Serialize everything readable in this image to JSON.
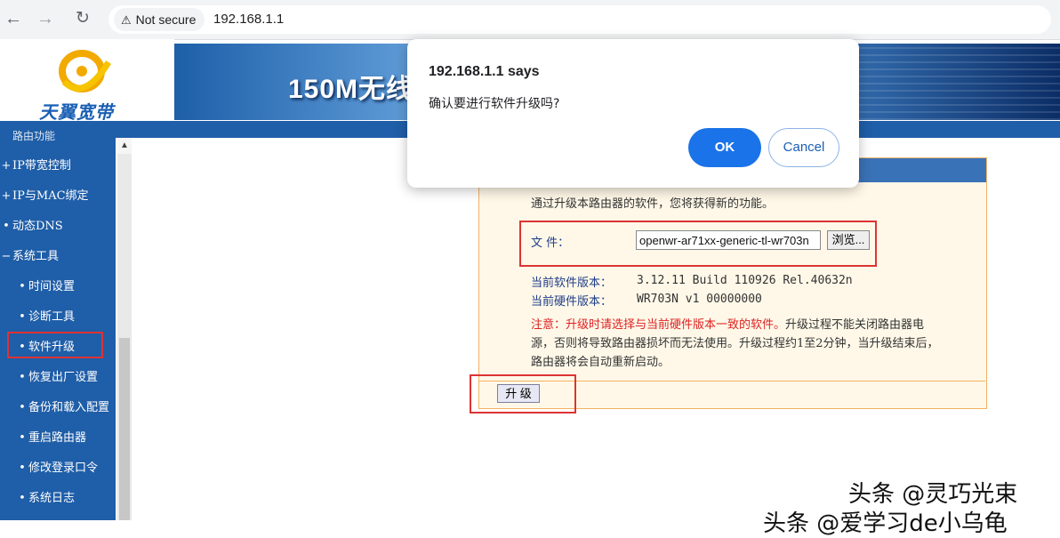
{
  "browser": {
    "back_icon": "arrow-left-icon",
    "forward_icon": "arrow-right-icon",
    "reload_icon": "reload-icon",
    "security_label": "Not secure",
    "url": "192.168.1.1"
  },
  "header": {
    "logo_text": "天翼宽带",
    "banner_text": "150M无线"
  },
  "sidebar": {
    "items": [
      {
        "bullet": "",
        "label": "路由功能"
      },
      {
        "bullet": "+",
        "label": "IP带宽控制"
      },
      {
        "bullet": "+",
        "label": "IP与MAC绑定"
      },
      {
        "bullet": "•",
        "label": "动态DNS"
      },
      {
        "bullet": "−",
        "label": "系统工具"
      }
    ],
    "sub_items": [
      {
        "label": "时间设置"
      },
      {
        "label": "诊断工具"
      },
      {
        "label": "软件升级"
      },
      {
        "label": "恢复出厂设置"
      },
      {
        "label": "备份和载入配置"
      },
      {
        "label": "重启路由器"
      },
      {
        "label": "修改登录口令"
      },
      {
        "label": "系统日志"
      }
    ]
  },
  "upgrade_panel": {
    "intro": "通过升级本路由器的软件，您将获得新的功能。",
    "file_label": "文 件：",
    "file_value": "openwr-ar71xx-generic-tl-wr703n",
    "browse_label": "浏览...",
    "current_software_label": "当前软件版本：",
    "current_software_value": "3.12.11 Build 110926 Rel.40632n",
    "current_hardware_label": "当前硬件版本：",
    "current_hardware_value": "WR703N v1 00000000",
    "note_prefix": "注意：",
    "note_red": "升级时请选择与当前硬件版本一致的软件。",
    "note_rest": "升级过程不能关闭路由器电源，否则将导致路由器损坏而无法使用。升级过程约1至2分钟，当升级结束后，路由器将会自动重新启动。",
    "upgrade_button": "升 级"
  },
  "dialog": {
    "title": "192.168.1.1 says",
    "message": "确认要进行软件升级吗?",
    "ok_label": "OK",
    "cancel_label": "Cancel"
  },
  "watermark": {
    "line1": "头条 @灵巧光束",
    "line2": "头条 @爱学习de小乌龟"
  },
  "colors": {
    "sidebar_bg": "#1f5ea8",
    "highlight_red": "#dd3333",
    "dialog_primary": "#1a73e8"
  }
}
